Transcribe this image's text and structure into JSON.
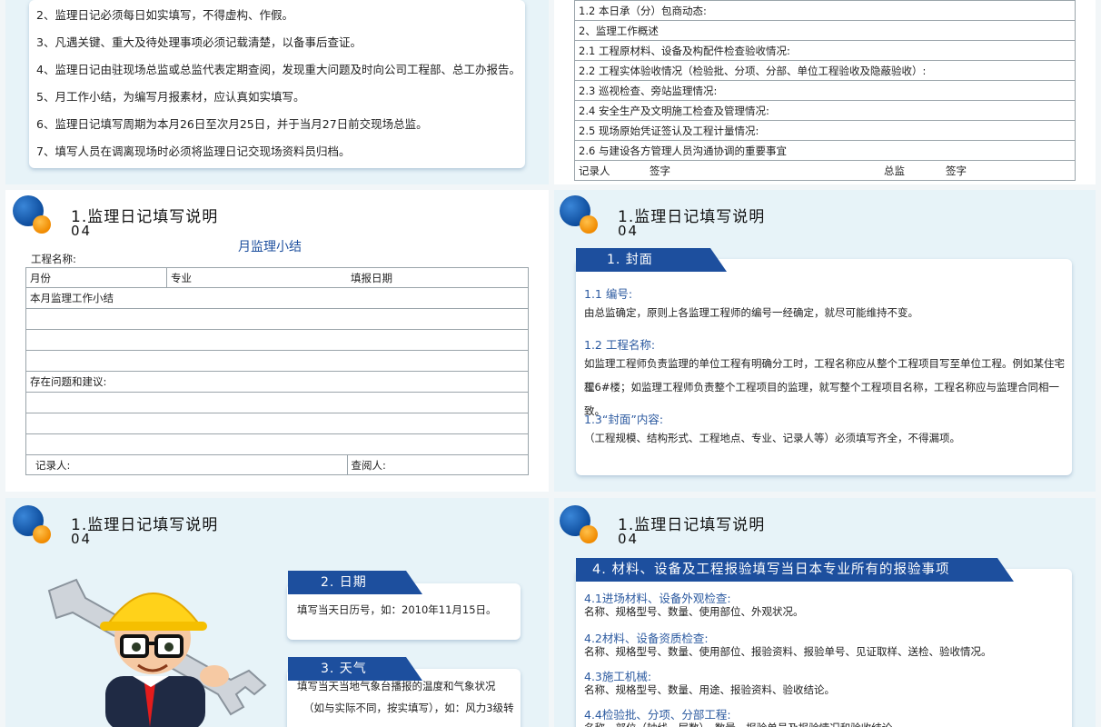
{
  "notes": [
    "2、监理日记必须每日如实填写，不得虚构、作假。",
    "3、凡遇关键、重大及待处理事项必须记载清楚，以备事后查证。",
    "4、监理日记由驻现场总监或总监代表定期查阅，发现重大问题及时向公司工程部、总工办报告。",
    "5、月工作小结，为编写月报素材，应认真如实填写。",
    "6、监理日记填写周期为本月26日至次月25日，并于当月27日前交现场总监。",
    "7、填写人员在调离现场时必须将监理日记交现场资料员归档。"
  ],
  "log_table": {
    "rows": [
      "1.2 本日承（分）包商动态:",
      "2、监理工作概述",
      "2.1 工程原材料、设备及构配件检查验收情况:",
      "2.2 工程实体验收情况（检验批、分项、分部、单位工程验收及隐蔽验收）:",
      "2.3 巡视检查、旁站监理情况:",
      "2.4 安全生产及文明施工检查及管理情况:",
      "2.5 现场原始凭证签认及工程计量情况:",
      "2.6 与建设各方管理人员沟通协调的重要事宜"
    ],
    "footer": {
      "recorder": "记录人",
      "sign1": "签字",
      "chief": "总监",
      "sign2": "签字"
    }
  },
  "header": {
    "title": "1.监理日记填写说明",
    "number": "04"
  },
  "monthly": {
    "title": "月监理小结",
    "project_label": "工程名称:",
    "col_month": "月份",
    "col_major": "专业",
    "col_date": "填报日期",
    "summary_label": "本月监理工作小结",
    "issues_label": "存在问题和建议:",
    "recorder_label": "记录人:",
    "reviewer_label": "查阅人:"
  },
  "cover": {
    "tab": "1. 封面",
    "items": [
      {
        "heading": "1.1 编号:",
        "text": [
          "由总监确定，原则上各监理工程师的编号一经确定，就尽可能维持不变。"
        ]
      },
      {
        "heading": "1.2 工程名称:",
        "text": [
          "如监理工程师负责监理的单位工程有明确分工时，工程名称应从整个工程项目写至单位工程。例如某住宅工",
          "程6#楼；如监理工程师负责整个工程项目的监理，就写整个工程项目名称，工程名称应与监理合同相一致。"
        ]
      },
      {
        "heading": "1.3“封面”内容:",
        "text": [
          "（工程规模、结构形式、工程地点、专业、记录人等）必须填写齐全，不得漏项。"
        ]
      }
    ]
  },
  "date_weather": {
    "date_tab": "2. 日期",
    "date_text": "填写当天日历号，如：2010年11月15日。",
    "weather_tab": "3. 天气",
    "weather_text": [
      "填写当天当地气象台播报的温度和气象状况",
      "（如与实际不同，按实填写），如：风力3级转"
    ]
  },
  "materials": {
    "tab": "4. 材料、设备及工程报验填写当日本专业所有的报验事项",
    "items": [
      {
        "heading": "4.1进场材料、设备外观检查:",
        "text": "名称、规格型号、数量、使用部位、外观状况。"
      },
      {
        "heading": "4.2材料、设备资质检查:",
        "text": "名称、规格型号、数量、使用部位、报验资料、报验单号、见证取样、送检、验收情况。"
      },
      {
        "heading": "4.3施工机械:",
        "text": "名称、规格型号、数量、用途、报验资料、验收结论。"
      },
      {
        "heading": "4.4检验批、分项、分部工程:",
        "text": "名称、部位（轴线、层数）、数量、报验单号及报验情况和验收结论"
      }
    ]
  },
  "colors": {
    "accent": "#1d4f9e",
    "orange": "#f08a00",
    "bg": "#e7f3f8"
  }
}
